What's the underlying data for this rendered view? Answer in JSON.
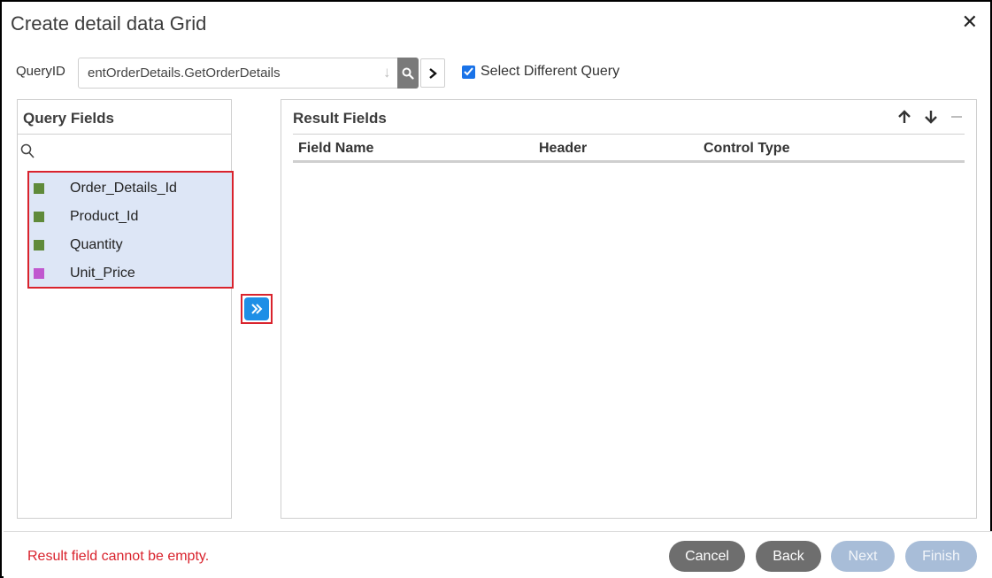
{
  "dialog": {
    "title": "Create detail data Grid",
    "close_glyph": "✕"
  },
  "query": {
    "label": "QueryID",
    "value": "entOrderDetails.GetOrderDetails",
    "select_different_label": "Select Different Query",
    "select_different_checked": true
  },
  "query_fields": {
    "title": "Query Fields",
    "items": [
      {
        "label": "Order_Details_Id",
        "color": "#5f8a3a"
      },
      {
        "label": "Product_Id",
        "color": "#5f8a3a"
      },
      {
        "label": "Quantity",
        "color": "#5f8a3a"
      },
      {
        "label": "Unit_Price",
        "color": "#c058cf"
      }
    ]
  },
  "result_fields": {
    "title": "Result Fields",
    "columns": [
      "Field Name",
      "Header",
      "Control Type"
    ]
  },
  "footer": {
    "error": "Result field cannot be empty.",
    "buttons": {
      "cancel": "Cancel",
      "back": "Back",
      "next": "Next",
      "finish": "Finish"
    }
  },
  "colors": {
    "accent": "#1e8fe6",
    "highlight_border": "#d9232d",
    "selection_bg": "#dde6f6"
  }
}
